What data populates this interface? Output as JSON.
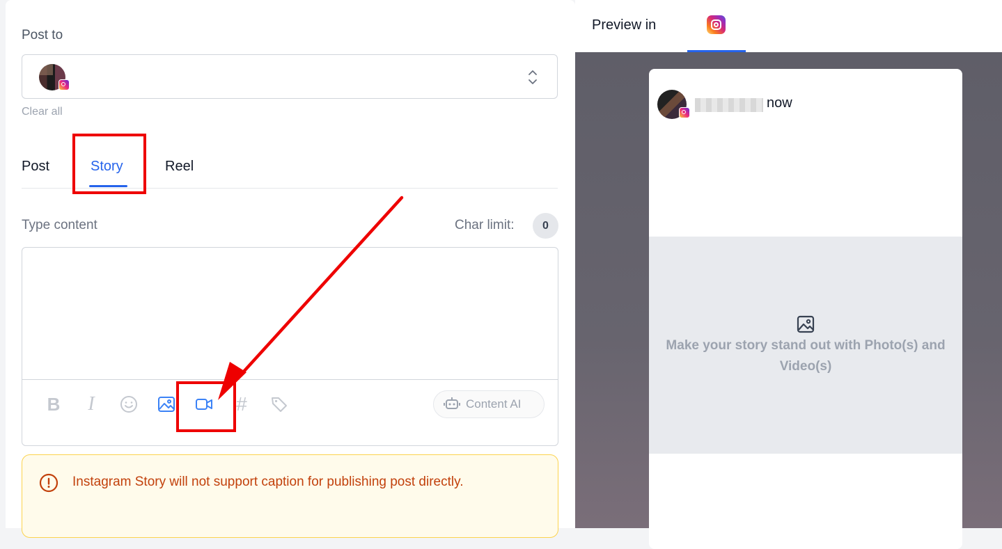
{
  "composer": {
    "post_to_label": "Post to",
    "clear_all_label": "Clear all",
    "tabs": [
      {
        "label": "Post",
        "active": false
      },
      {
        "label": "Story",
        "active": true
      },
      {
        "label": "Reel",
        "active": false
      }
    ],
    "type_content_label": "Type content",
    "char_limit_label": "Char limit:",
    "char_count": "0",
    "toolbar": {
      "icons": [
        "bold-icon",
        "italic-icon",
        "emoji-icon",
        "image-icon",
        "video-icon",
        "hashtag-icon",
        "tag-icon"
      ],
      "content_ai_label": "Content AI"
    },
    "warning_text": "Instagram Story will not support caption for publishing post directly."
  },
  "preview": {
    "label": "Preview in",
    "platform_icon": "instagram-icon",
    "time_label": "now",
    "media_prompt": "Make your story stand out with Photo(s) and Video(s)"
  },
  "colors": {
    "accent": "#2563eb",
    "annotation": "#ee0000",
    "warning_text": "#c2410c",
    "warning_bg": "#fffbeb"
  }
}
